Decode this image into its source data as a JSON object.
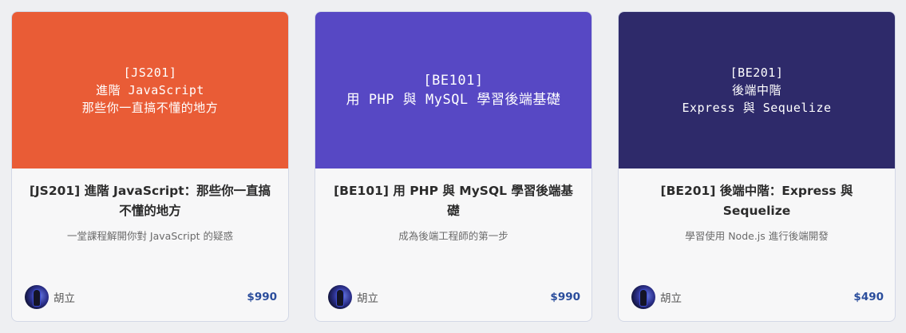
{
  "courses": [
    {
      "cover_color": "#e95c36",
      "cover_lines": [
        "[JS201]",
        "進階 JavaScript",
        "那些你一直搞不懂的地方"
      ],
      "title": "[JS201] 進階 JavaScript：那些你一直搞不懂的地方",
      "subtitle": "一堂課程解開你對 JavaScript 的疑惑",
      "author": "胡立",
      "price": "$990"
    },
    {
      "cover_color": "#5748c4",
      "cover_lines": [
        "[BE101]",
        "用 PHP 與 MySQL 學習後端基礎"
      ],
      "title": "[BE101] 用 PHP 與 MySQL 學習後端基礎",
      "subtitle": "成為後端工程師的第一步",
      "author": "胡立",
      "price": "$990"
    },
    {
      "cover_color": "#2e2a6a",
      "cover_lines": [
        "[BE201]",
        "後端中階",
        "Express 與 Sequelize"
      ],
      "title": "[BE201] 後端中階：Express 與 Sequelize",
      "subtitle": "學習使用 Node.js 進行後端開發",
      "author": "胡立",
      "price": "$490"
    }
  ]
}
